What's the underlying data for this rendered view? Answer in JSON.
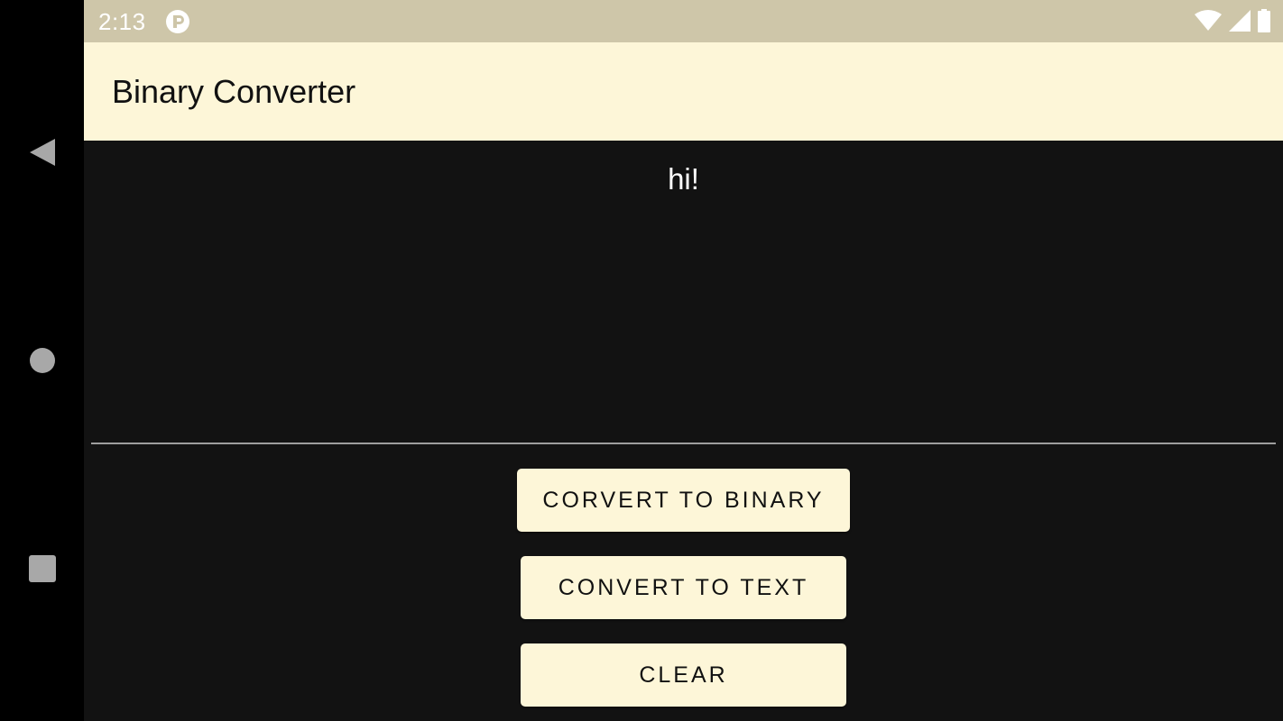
{
  "status_bar": {
    "time": "2:13",
    "icons": [
      "app-notification-icon",
      "wifi-icon",
      "signal-icon",
      "battery-icon"
    ]
  },
  "app_bar": {
    "title": "Binary Converter"
  },
  "output": {
    "text": "hi!"
  },
  "input": {
    "value": "",
    "placeholder": ""
  },
  "buttons": {
    "to_binary": "CORVERT TO BINARY",
    "to_text": "CONVERT TO TEXT",
    "clear": "CLEAR"
  },
  "navigation": {
    "icons": [
      "back-icon",
      "home-icon",
      "recents-icon"
    ]
  },
  "colors": {
    "status_bar": "#cec6a9",
    "app_bar": "#fdf6d8",
    "background": "#121212",
    "button": "#fdf6d8"
  }
}
